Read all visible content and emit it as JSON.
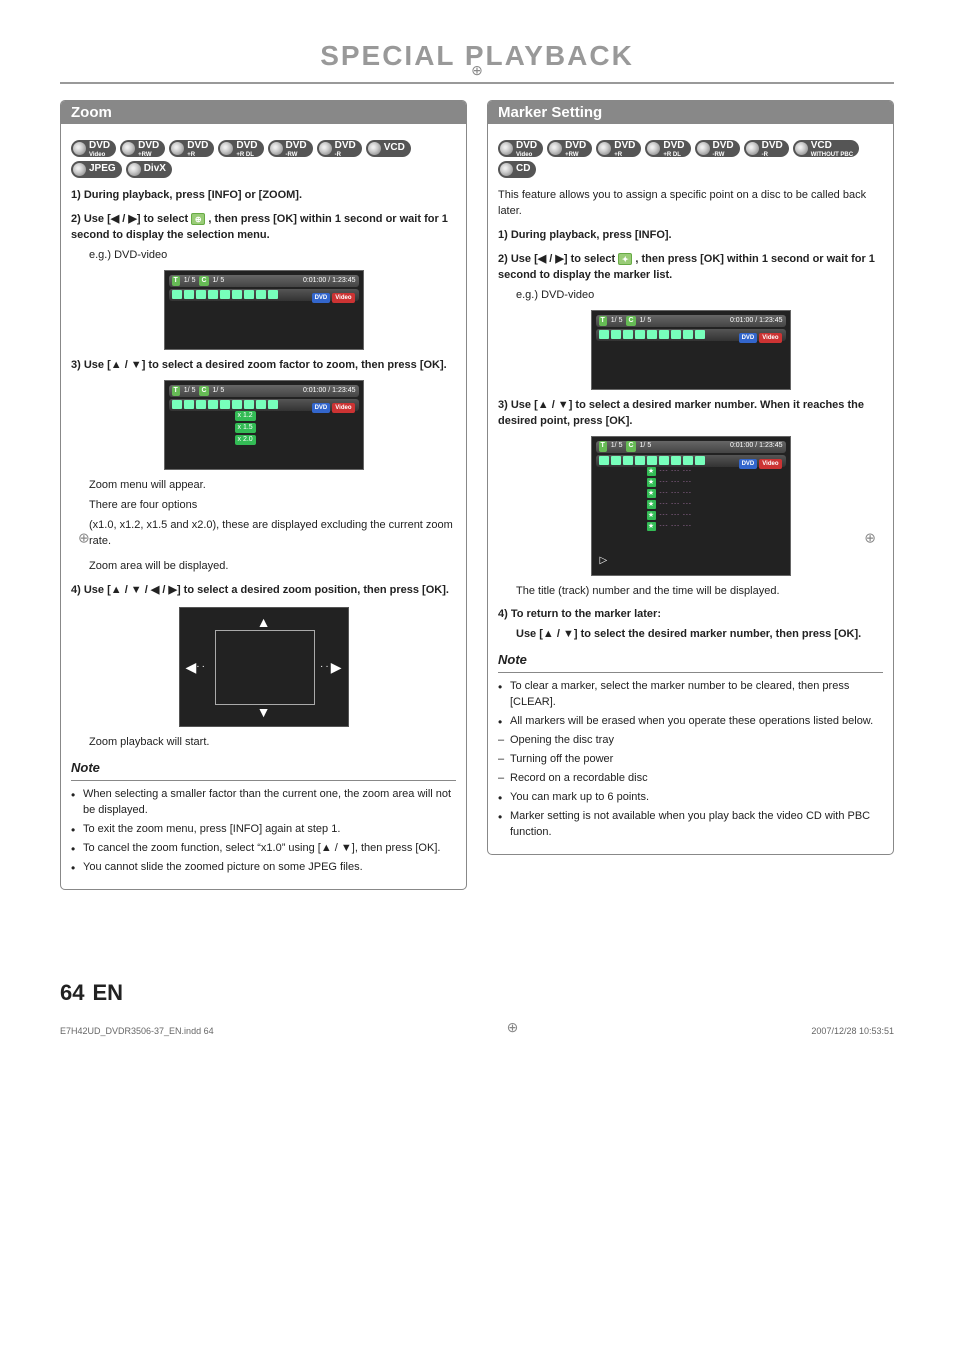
{
  "page": {
    "title": "SPECIAL PLAYBACK",
    "number": "64",
    "lang": "EN",
    "footer_file": "E7H42UD_DVDR3506-37_EN.indd   64",
    "footer_date": "2007/12/28   10:53:51"
  },
  "badges": {
    "zoom": [
      "DVD Video",
      "DVD +RW",
      "DVD +R",
      "DVD +R DL",
      "DVD -RW",
      "DVD -R",
      "VCD",
      "JPEG",
      "DivX"
    ],
    "marker": [
      "DVD Video",
      "DVD +RW",
      "DVD +R",
      "DVD +R DL",
      "DVD -RW",
      "DVD -R",
      "VCD WITHOUT PBC",
      "CD"
    ]
  },
  "zoom": {
    "header": "Zoom",
    "step1": "1) During playback, press [INFO] or [ZOOM].",
    "step2_a": "2) Use [",
    "step2_b": "] to select",
    "step2_c": ", then press [OK] within 1 second or wait for 1 second to display the selection menu.",
    "arrows_lr": "◀ / ▶",
    "eg": "e.g.) DVD-video",
    "screen": {
      "t": "T",
      "t_val": "1/  5",
      "c": "C",
      "c_val": "1/  5",
      "time": "0:01:00 / 1:23:45",
      "dvd": "DVD",
      "video": "Video"
    },
    "step3_a": "3) Use [",
    "step3_b": "] to select a desired zoom factor to zoom, then press [OK].",
    "arrows_ud": "▲ / ▼",
    "zoom_opts": [
      "x 1.2",
      "x 1.5",
      "x 2.0"
    ],
    "after3_1": "Zoom menu will appear.",
    "after3_2": "There are four options",
    "after3_3": "(x1.0, x1.2, x1.5 and x2.0), these are displayed excluding the current zoom rate.",
    "after3_4": "Zoom area will be displayed.",
    "step4_a": "4) Use [",
    "step4_b": "] to select a desired zoom position, then press [OK].",
    "arrows_all": "▲ / ▼ / ◀ / ▶",
    "after4": "Zoom playback will start.",
    "note_title": "Note",
    "notes": [
      "When selecting a smaller factor than the current one, the zoom area will not be displayed.",
      "To exit the zoom menu, press [INFO] again at step 1.",
      "To cancel the zoom function, select “x1.0” using [▲ / ▼], then press [OK].",
      "You cannot slide the zoomed picture on some JPEG files."
    ]
  },
  "marker": {
    "header": "Marker Setting",
    "intro": "This feature allows you to assign a specific point on a disc to be called back later.",
    "step1": "1) During playback, press [INFO].",
    "step2_a": "2) Use [",
    "step2_b": "] to select",
    "step2_c": ", then press [OK] within 1 second or wait for 1 second to display the marker list.",
    "eg": "e.g.) DVD-video",
    "screen": {
      "t": "T",
      "t_val": "1/  5",
      "c": "C",
      "c_val": "1/  5",
      "time": "0:01:00 / 1:23:45",
      "dvd": "DVD",
      "video": "Video",
      "play": "▷"
    },
    "step3_a": "3) Use [",
    "step3_b": "] to select a desired marker number. When it reaches the desired point, press [OK].",
    "after3": "The title (track) number and the time will be displayed.",
    "step4_title": "4) To return to the marker later:",
    "step4_a": "Use [",
    "step4_b": "] to select the desired marker number, then press [OK].",
    "note_title": "Note",
    "notes": [
      {
        "type": "bullet",
        "text": "To clear a marker, select the marker number to be cleared, then press [CLEAR]."
      },
      {
        "type": "bullet",
        "text": "All markers will be erased when you operate these operations listed below."
      },
      {
        "type": "dash",
        "text": "Opening the disc tray"
      },
      {
        "type": "dash",
        "text": "Turning off the power"
      },
      {
        "type": "dash",
        "text": "Record on a recordable disc"
      },
      {
        "type": "bullet",
        "text": "You can mark up to 6 points."
      },
      {
        "type": "bullet",
        "text": "Marker setting is not available when you play back the video CD with PBC function."
      }
    ]
  }
}
